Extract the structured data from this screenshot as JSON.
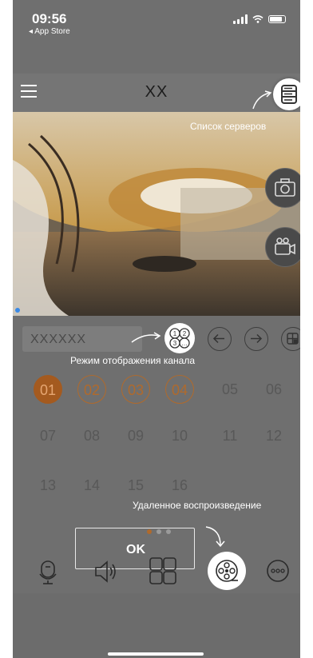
{
  "status_bar": {
    "time": "09:56",
    "back_app": "◂ App Store"
  },
  "header": {
    "title": "XX"
  },
  "tips": {
    "server_list": "Список серверов",
    "channel_display_mode": "Режим отображения канала",
    "remote_playback": "Удаленное воспроизведение"
  },
  "channel_selector": {
    "value": "XXXXXX"
  },
  "channels": {
    "row1": [
      "01",
      "02",
      "03",
      "04",
      "05",
      "06"
    ],
    "row2": [
      "07",
      "08",
      "09",
      "10",
      "11",
      "12"
    ],
    "row3": [
      "13",
      "14",
      "15",
      "16"
    ]
  },
  "dialog": {
    "ok_label": "OK"
  },
  "colors": {
    "accent": "#b06a2c",
    "overlay": "#6f6f6f"
  },
  "icons": [
    "menu-icon",
    "server-list-icon",
    "camera-icon",
    "video-record-icon",
    "channel-mode-icon",
    "prev-icon",
    "next-icon",
    "layout-icon",
    "microphone-icon",
    "speaker-icon",
    "grid-icon",
    "film-reel-icon",
    "more-icon"
  ]
}
